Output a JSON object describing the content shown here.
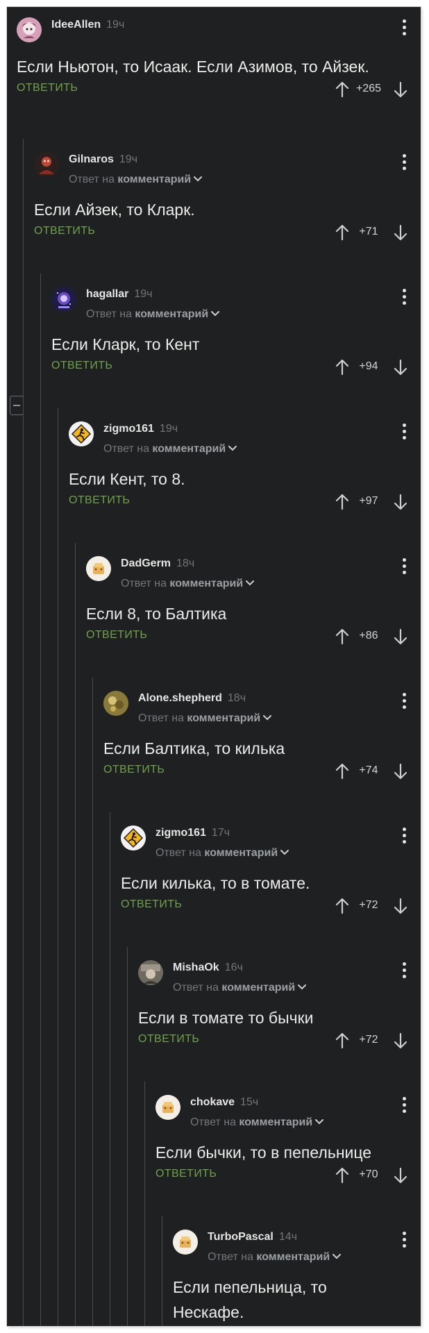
{
  "ui": {
    "reply_label": "ОТВЕТИТЬ",
    "reply_to_prefix": "Ответ на",
    "reply_to_link": "комментарий"
  },
  "comments": [
    {
      "user": "IdeeAllen",
      "time": "19ч",
      "text": "Если Ньютон, то Исаак. Если Азимов, то Айзек.",
      "rating": "+265",
      "avatar_icon": "anime-avatar-icon",
      "avatar_color": "#d6a1b8",
      "is_reply": false
    },
    {
      "user": "Gilnaros",
      "time": "19ч",
      "text": "Если Айзек, то Кларк.",
      "rating": "+71",
      "avatar_icon": "dark-figure-avatar-icon",
      "avatar_color": "#3a2a28",
      "is_reply": true
    },
    {
      "user": "hagallar",
      "time": "19ч",
      "text": "Если Кларк, то Кент",
      "rating": "+94",
      "avatar_icon": "cosmic-avatar-icon",
      "avatar_color": "#2c2a5e",
      "is_reply": true
    },
    {
      "user": "zigmo161",
      "time": "19ч",
      "text": "Если Кент, то 8.",
      "rating": "+97",
      "avatar_icon": "warning-sign-avatar-icon",
      "avatar_color": "#f0f0f0",
      "is_reply": true
    },
    {
      "user": "DadGerm",
      "time": "18ч",
      "text": "Если 8, то Балтика",
      "rating": "+86",
      "avatar_icon": "default-avatar-icon",
      "avatar_color": "#f4f0ea",
      "is_reply": true
    },
    {
      "user": "Alone.shepherd",
      "time": "18ч",
      "text": "Если Балтика, то килька",
      "rating": "+74",
      "avatar_icon": "shepherd-avatar-icon",
      "avatar_color": "#8a7a3a",
      "is_reply": true
    },
    {
      "user": "zigmo161",
      "time": "17ч",
      "text": "Если килька, то в томате.",
      "rating": "+72",
      "avatar_icon": "warning-sign-avatar-icon",
      "avatar_color": "#f0f0f0",
      "is_reply": true
    },
    {
      "user": "MishaOk",
      "time": "16ч",
      "text": "Если в томате то бычки",
      "rating": "+72",
      "avatar_icon": "photo-avatar-icon",
      "avatar_color": "#6f6a60",
      "is_reply": true
    },
    {
      "user": "chokave",
      "time": "15ч",
      "text": "Если бычки, то в пепельнице",
      "rating": "+70",
      "avatar_icon": "default-avatar-icon",
      "avatar_color": "#f4f0ea",
      "is_reply": true
    },
    {
      "user": "TurboPascal",
      "time": "14ч",
      "text": "Если пепельница, то Нескафе.",
      "rating": "",
      "avatar_icon": "default-avatar-icon",
      "avatar_color": "#f4f0ea",
      "is_reply": true
    }
  ],
  "colors": {
    "background": "#1f2021",
    "reply_accent": "#70a14b",
    "thread_line": "#4a4c50"
  }
}
